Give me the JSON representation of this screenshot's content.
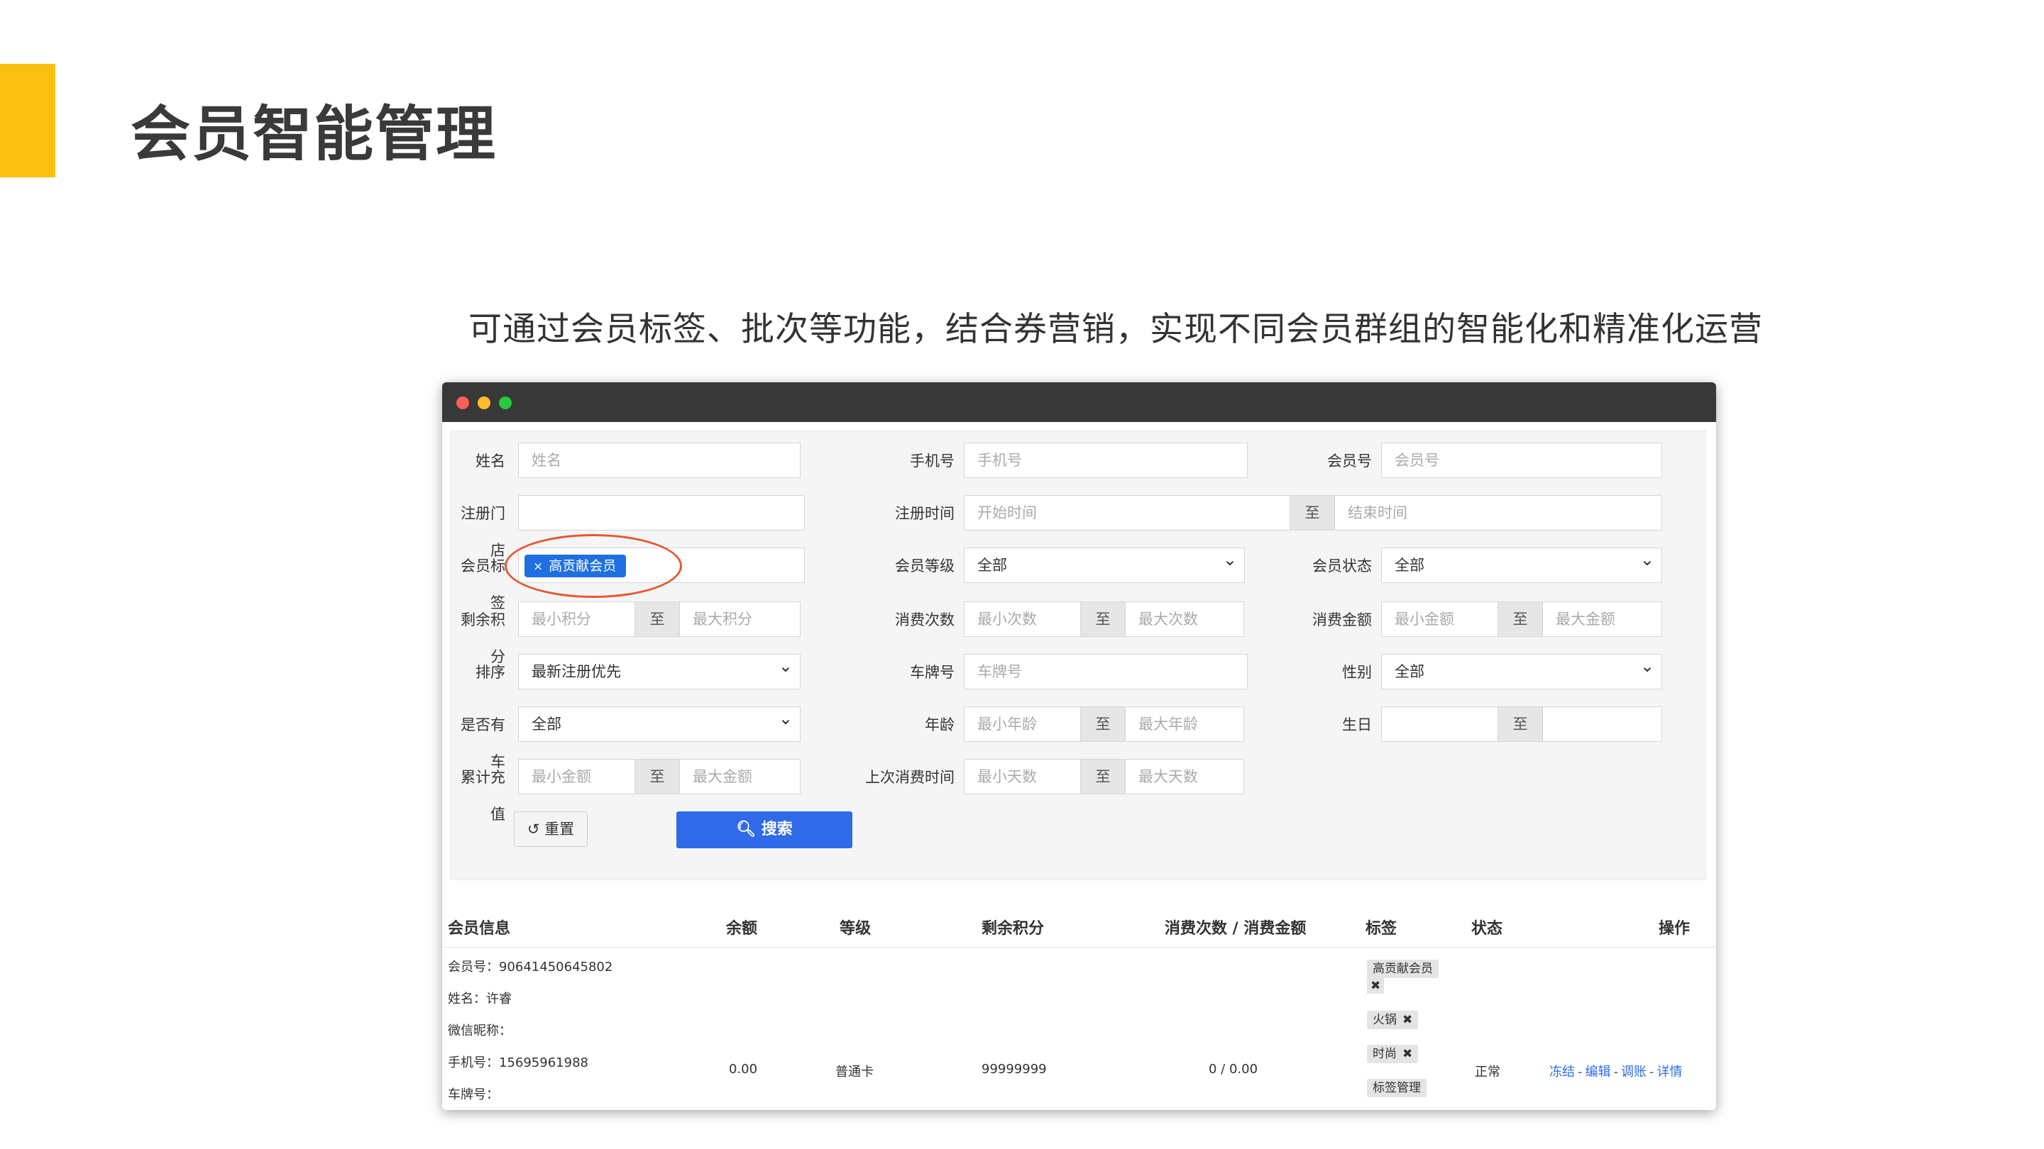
{
  "slide": {
    "title": "会员智能管理",
    "subtitle": "可通过会员标签、批次等功能，结合券营销，实现不同会员群组的智能化和精准化运营",
    "accent_color": "#fbbf12"
  },
  "filters": {
    "name": {
      "label": "姓名",
      "placeholder": "姓名"
    },
    "phone": {
      "label": "手机号",
      "placeholder": "手机号"
    },
    "member_no": {
      "label": "会员号",
      "placeholder": "会员号"
    },
    "store": {
      "label": "注册门店",
      "value": ""
    },
    "reg_time": {
      "label": "注册时间",
      "start_placeholder": "开始时间",
      "sep": "至",
      "end_placeholder": "结束时间"
    },
    "member_tag": {
      "label": "会员标签",
      "chip": "高贡献会员",
      "chip_close": "×"
    },
    "level": {
      "label": "会员等级",
      "value": "全部"
    },
    "status": {
      "label": "会员状态",
      "value": "全部"
    },
    "points": {
      "label": "剩余积分",
      "min_placeholder": "最小积分",
      "sep": "至",
      "max_placeholder": "最大积分"
    },
    "consume_count": {
      "label": "消费次数",
      "min_placeholder": "最小次数",
      "sep": "至",
      "max_placeholder": "最大次数"
    },
    "consume_amount": {
      "label": "消费金额",
      "min_placeholder": "最小金额",
      "sep": "至",
      "max_placeholder": "最大金额"
    },
    "sort": {
      "label": "排序",
      "value": "最新注册优先"
    },
    "plate": {
      "label": "车牌号",
      "placeholder": "车牌号"
    },
    "gender": {
      "label": "性别",
      "value": "全部"
    },
    "has_car": {
      "label": "是否有车",
      "value": "全部"
    },
    "age": {
      "label": "年龄",
      "min_placeholder": "最小年龄",
      "sep": "至",
      "max_placeholder": "最大年龄"
    },
    "birthday": {
      "label": "生日",
      "sep": "至"
    },
    "recharge": {
      "label": "累计充值",
      "min_placeholder": "最小金额",
      "sep": "至",
      "max_placeholder": "最大金额"
    },
    "last_consume": {
      "label": "上次消费时间",
      "min_placeholder": "最小天数",
      "sep": "至",
      "max_placeholder": "最大天数"
    },
    "reset_label": "重置",
    "search_label": "搜索"
  },
  "table": {
    "headers": [
      "会员信息",
      "余额",
      "等级",
      "剩余积分",
      "消费次数 / 消费金额",
      "标签",
      "状态",
      "操作"
    ],
    "row": {
      "info": [
        "会员号：90641450645802",
        "姓名：许睿",
        "微信昵称：",
        "手机号：15695961988",
        "车牌号："
      ],
      "balance": "0.00",
      "level": "普通卡",
      "points": "99999999",
      "consume": "0 / 0.00",
      "tags": [
        "高贡献会员",
        "火锅",
        "时尚"
      ],
      "tag_remove": "✖",
      "tag_manage": "标签管理",
      "status": "正常",
      "ops": [
        "冻结",
        "编辑",
        "调账",
        "详情"
      ],
      "ops_sep": "-"
    }
  }
}
